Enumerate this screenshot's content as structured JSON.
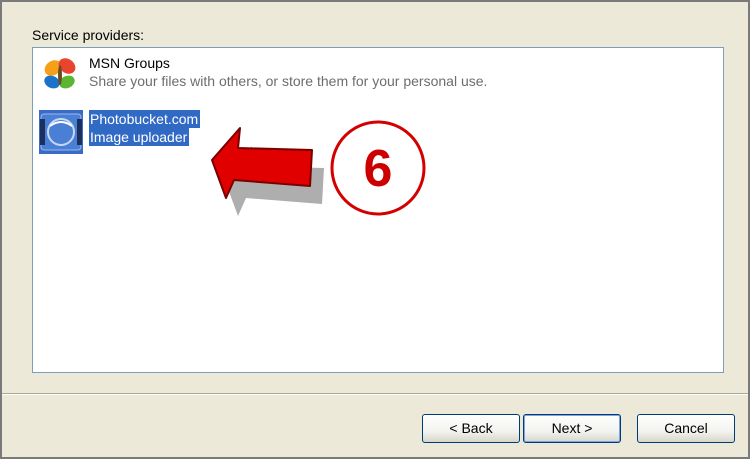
{
  "dialog": {
    "group_label": "Service providers:",
    "providers": [
      {
        "title": "MSN Groups",
        "description": "Share your files with others, or store them for your personal use.",
        "icon": "msn-butterfly-icon",
        "selected": false
      },
      {
        "title": "Photobucket.com",
        "description": "Image uploader",
        "icon": "photobucket-icon",
        "selected": true
      }
    ]
  },
  "annotation": {
    "step_number": "6",
    "color": "#e00000"
  },
  "buttons": {
    "back": "< Back",
    "next": "Next >",
    "cancel": "Cancel"
  },
  "colors": {
    "dialog_background": "#ece9d8",
    "selection": "#316ac5",
    "list_border": "#7f9db9"
  }
}
